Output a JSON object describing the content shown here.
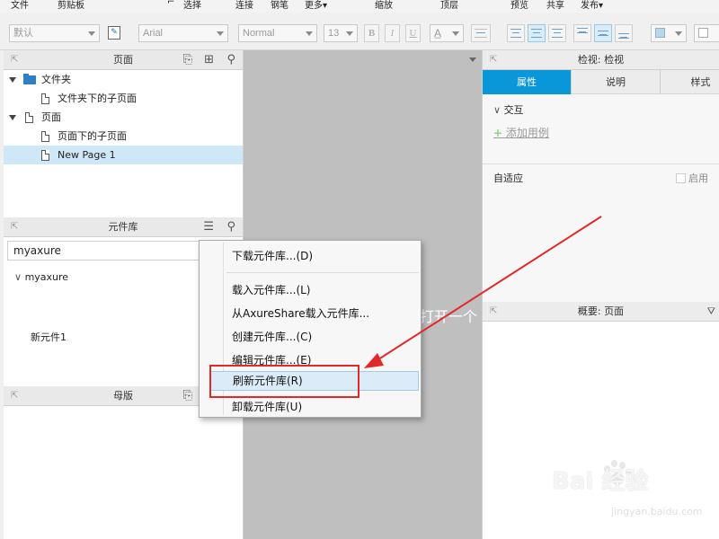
{
  "menubar": {
    "items": [
      "文件",
      "剪贴板",
      "选择",
      "连接",
      "钢笔",
      "更多▾",
      "缩放",
      "顶层",
      "预览",
      "共享",
      "发布▾"
    ]
  },
  "toolbar": {
    "style_select": "默认",
    "font_select": "Arial",
    "weight_select": "Normal",
    "size_select": "13",
    "bold": "B",
    "italic": "I",
    "underline": "U"
  },
  "pages_panel": {
    "title": "页面",
    "items": [
      {
        "label": "文件夹",
        "type": "folder",
        "level": 0
      },
      {
        "label": "文件夹下的子页面",
        "type": "page",
        "level": 1
      },
      {
        "label": "页面",
        "type": "page",
        "level": 0
      },
      {
        "label": "页面下的子页面",
        "type": "page",
        "level": 1
      },
      {
        "label": "New Page 1",
        "type": "page",
        "level": 1,
        "selected": true
      }
    ]
  },
  "library_panel": {
    "title": "元件库",
    "selected_library": "myaxure",
    "group_label": "myaxure",
    "widget_label": "新元件1"
  },
  "masters_panel": {
    "title": "母版"
  },
  "canvas": {
    "partial_text": "打开一个"
  },
  "inspector": {
    "title": "检视: 检视",
    "tabs": [
      "属性",
      "说明",
      "样式"
    ],
    "active_tab": "属性",
    "interaction_label": "交互",
    "add_case_label": "添加用例",
    "adaptive_label": "自适应",
    "enable_label": "启用"
  },
  "overview": {
    "title": "概要: 页面"
  },
  "context_menu": {
    "items": [
      "下载元件库...(D)",
      "载入元件库...(L)",
      "从AxureShare载入元件库...",
      "创建元件库...(C)",
      "编辑元件库...(E)",
      "刷新元件库(R)",
      "卸载元件库(U)"
    ],
    "highlighted": "刷新元件库(R)"
  },
  "annotation": {
    "color": "#e02a2a"
  },
  "watermark": {
    "brand": "Bai  经验",
    "url": "jingyan.baidu.com"
  }
}
